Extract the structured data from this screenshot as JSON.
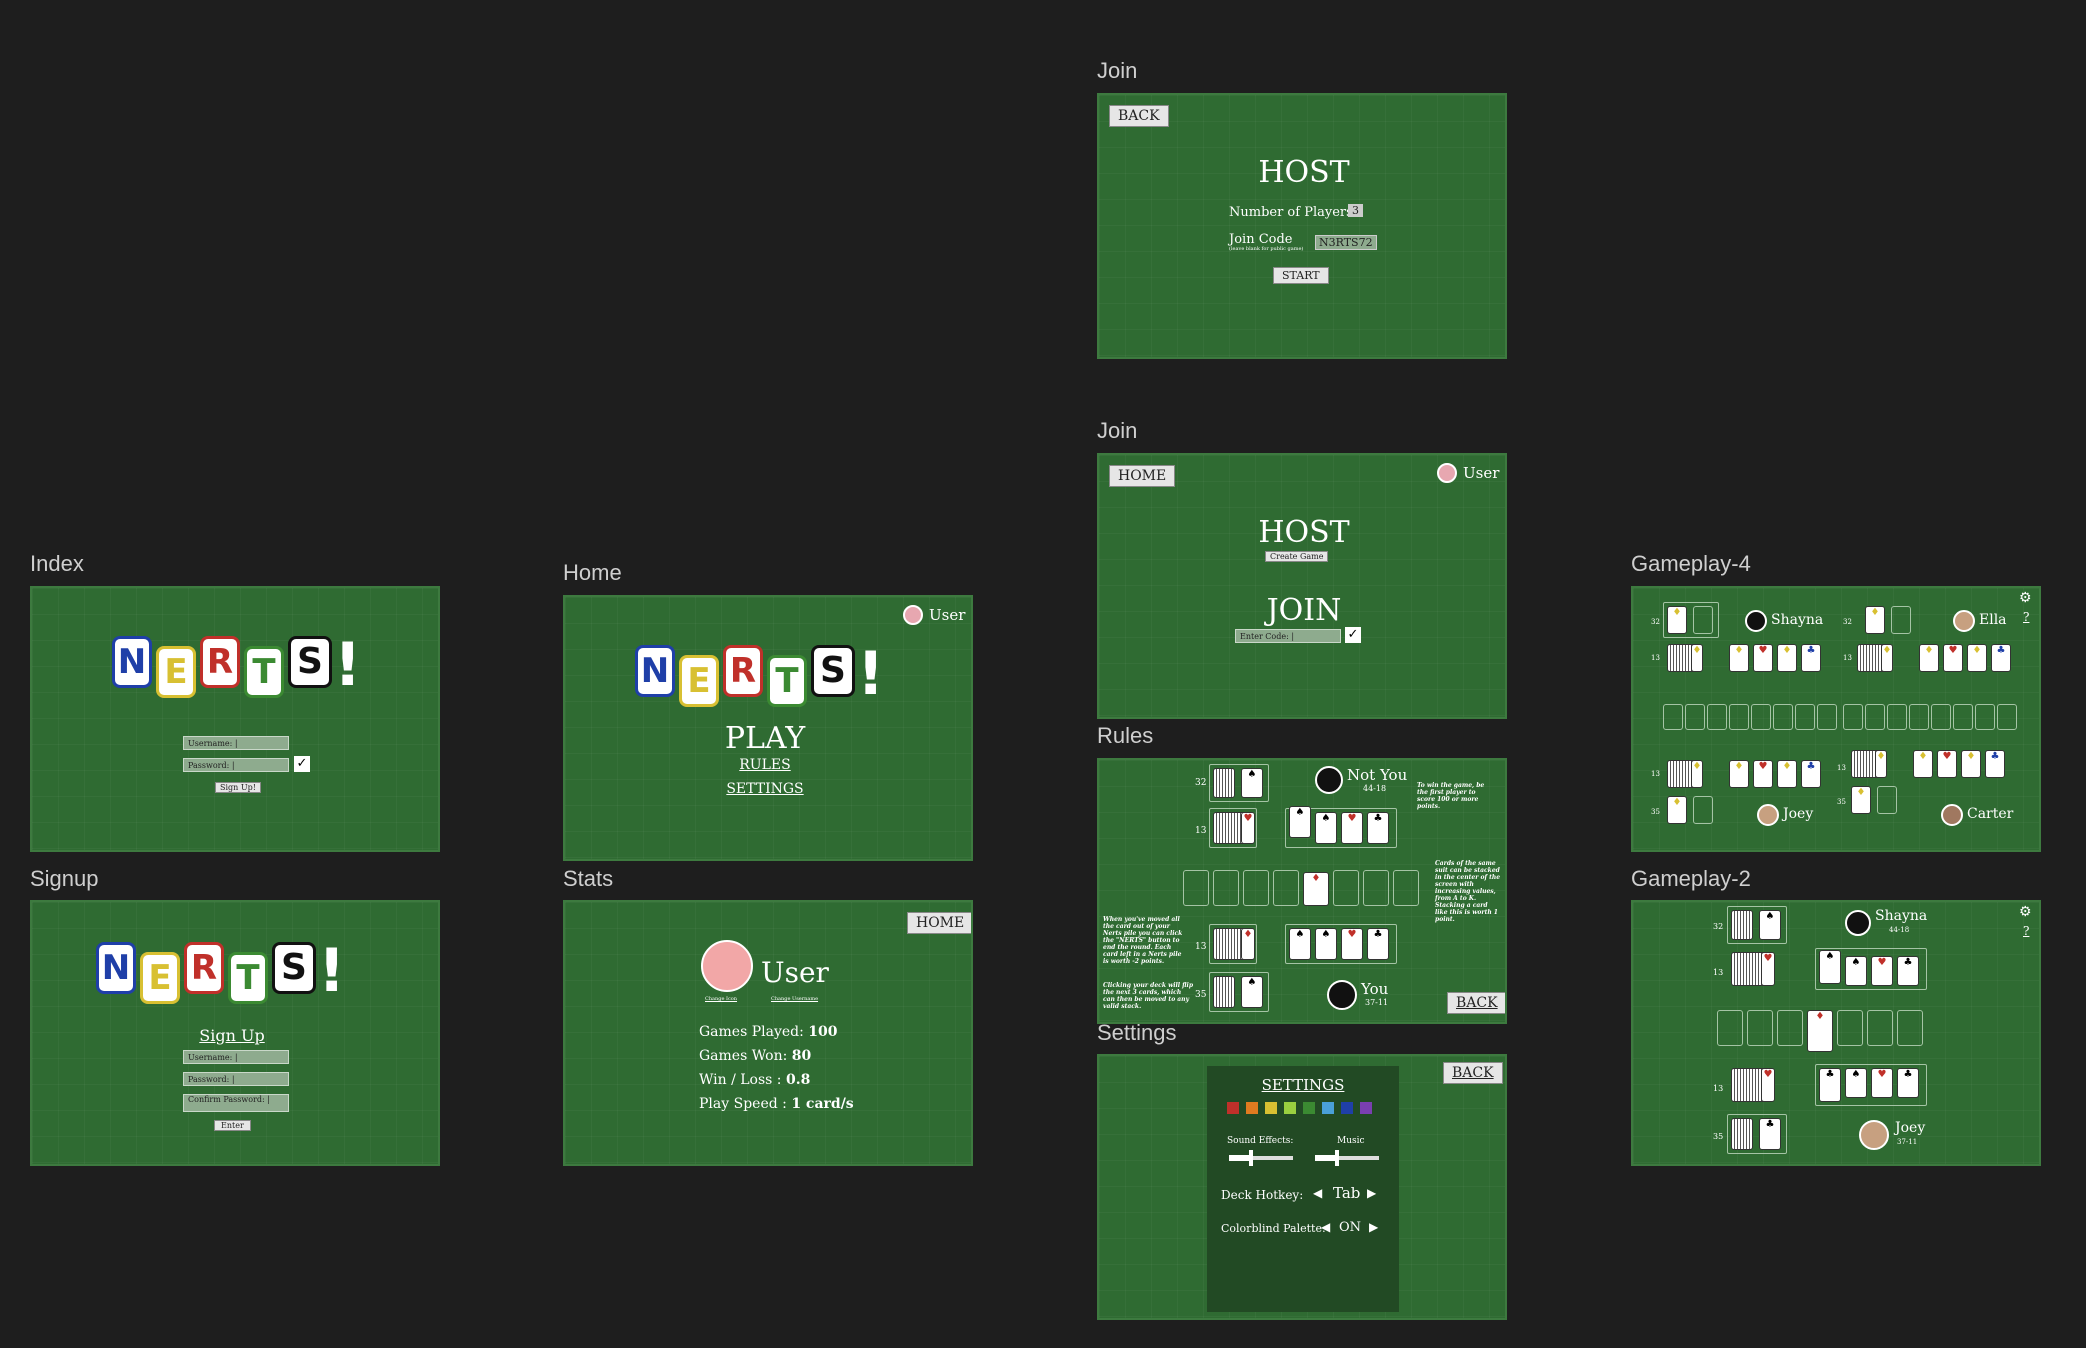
{
  "labels": {
    "join_host": "Join",
    "join_home": "Join",
    "rules": "Rules",
    "settings": "Settings",
    "index": "Index",
    "home": "Home",
    "signup": "Signup",
    "stats": "Stats",
    "gp4": "Gameplay-4",
    "gp2": "Gameplay-2"
  },
  "logo": {
    "letters": [
      "N",
      "E",
      "R",
      "T",
      "S"
    ],
    "bang": "!"
  },
  "colors": {
    "bg": "#1e1e1e",
    "felt": "#2f6b32",
    "n": "#1f3fa8",
    "e": "#d8c032",
    "r": "#c0302a",
    "t": "#3b8a32",
    "s": "#111111"
  },
  "join_host": {
    "back": "BACK",
    "title": "HOST",
    "players_label": "Number of Players:",
    "players_value": "3",
    "code_label": "Join Code",
    "code_sub": "(leave blank for public game)",
    "code_value": "N3RTS72",
    "start": "START"
  },
  "join_home": {
    "home": "HOME",
    "user": "User",
    "host": "HOST",
    "create": "Create Game",
    "join": "JOIN",
    "enter": "Enter Code: |",
    "check": "✓"
  },
  "index": {
    "username": "Username: |",
    "password": "Password: |",
    "check": "✓",
    "signup": "Sign Up!"
  },
  "home": {
    "user": "User",
    "play": "PLAY",
    "rules": "RULES",
    "settings": "SETTINGS"
  },
  "signup": {
    "title": "Sign Up",
    "username": "Username: |",
    "password": "Password: |",
    "confirm": "Confirm Password: |",
    "enter": "Enter"
  },
  "stats": {
    "home": "HOME",
    "user": "User",
    "change_icon": "Change Icon",
    "change_username": "Change Username",
    "games_played_label": "Games Played:",
    "games_played": "100",
    "games_won_label": "Games Won:",
    "games_won": "80",
    "ratio_label": "Win / Loss :",
    "ratio": "0.8",
    "speed_label": "Play Speed :",
    "speed": "1 card/s"
  },
  "rules": {
    "opponent": "Not You",
    "opponent_score": "44-18",
    "me": "You",
    "me_score": "37-11",
    "n32": "32",
    "n13a": "13",
    "n13b": "13",
    "n35": "35",
    "note_win": "To win the game, be the first player to score 100 or more points.",
    "note_center": "Cards of the same suit can be stacked in the center of the screen with increasing values, from A to K. Stacking a card like this is worth 1 point.",
    "note_nerts": "When you've moved all the card out of your Nerts pile you can click the \"NERTS\" button to end the round. Each card left in a Nerts pile is worth -2 points.",
    "note_deck": "Clicking your deck will flip the next 3 cards, which can then be moved to any valid stack.",
    "back": "BACK"
  },
  "settings": {
    "title": "SETTINGS",
    "back": "BACK",
    "swatches": [
      "#c0302a",
      "#e07b20",
      "#d8c032",
      "#9ad040",
      "#3b8a32",
      "#4aa0d8",
      "#1f3fa8",
      "#7a3fb0"
    ],
    "sound_label": "Sound Effects:",
    "music_label": "Music",
    "sound_level": 0.35,
    "music_level": 0.35,
    "hotkey_label": "Deck Hotkey:",
    "hotkey_value": "Tab",
    "palette_label": "Colorblind Palette:",
    "palette_value": "ON",
    "left": "◀",
    "right": "▶"
  },
  "gp4": {
    "p1": "Shayna",
    "p2": "Ella",
    "p3": "Joey",
    "p4": "Carter",
    "n32a": "32",
    "n32b": "32",
    "n13a": "13",
    "n13b": "13",
    "n13c": "13",
    "n13d": "13",
    "n35a": "35",
    "n35b": "35",
    "help": "?"
  },
  "gp2": {
    "p1": "Shayna",
    "p1_score": "44-18",
    "p2": "Joey",
    "p2_score": "37-11",
    "n32": "32",
    "n13a": "13",
    "n13b": "13",
    "n35": "35",
    "help": "?"
  }
}
